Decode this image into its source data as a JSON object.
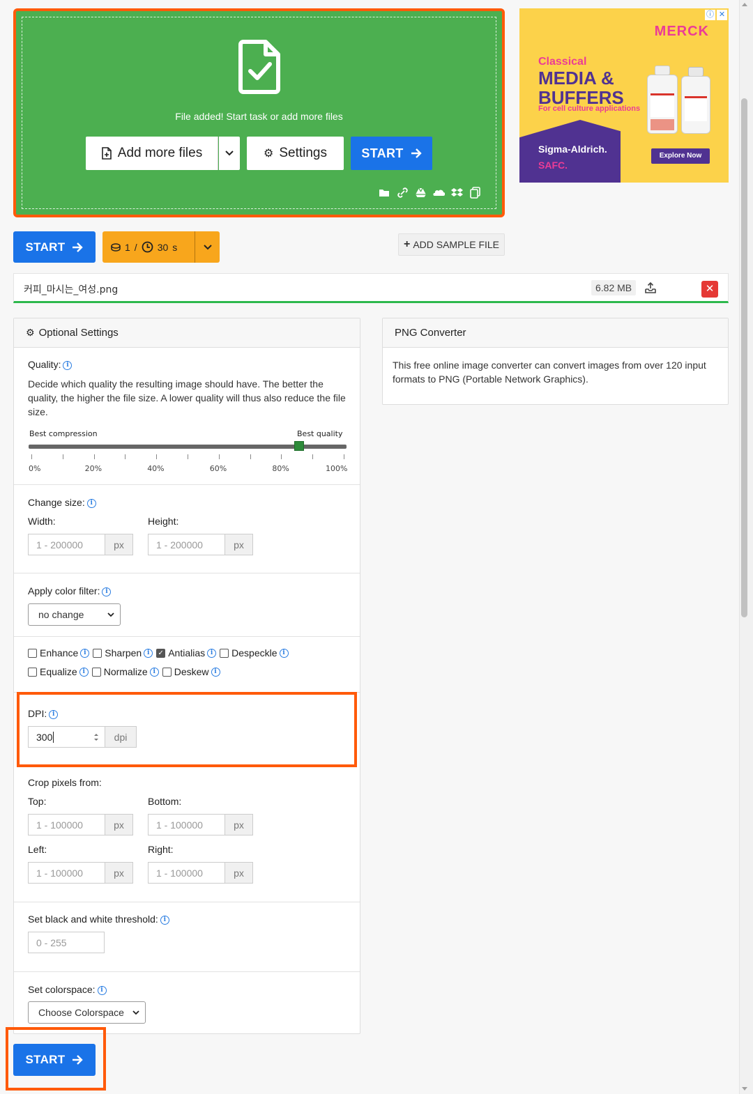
{
  "upload": {
    "message": "File added! Start task or add more files",
    "add_more_label": "Add more files",
    "settings_label": "Settings",
    "start_label": "START",
    "source_icons": [
      "folder-icon",
      "link-icon",
      "google-drive-icon",
      "onedrive-icon",
      "dropbox-icon",
      "clipboard-icon"
    ]
  },
  "ad": {
    "brand": "MERCK",
    "small_title": "Classical",
    "headline": "MEDIA & BUFFERS",
    "tagline": "For cell culture applications",
    "sigma": "Sigma-Aldrich.",
    "safc": "SAFC.",
    "cta": "Explore Now",
    "colors": {
      "bg": "#fcd24a",
      "purple": "#503291",
      "pink": "#eb3c96"
    }
  },
  "actions": {
    "start_label": "START",
    "credits_count": "1",
    "credits_sep": "/",
    "time_value": "30",
    "time_unit": "s",
    "sample_label": "ADD SAMPLE FILE"
  },
  "file": {
    "name": "커피_마시는_여성.png",
    "size": "6.82 MB",
    "delete_glyph": "✕"
  },
  "settings": {
    "title": "Optional Settings",
    "quality": {
      "label": "Quality:",
      "description": "Decide which quality the resulting image should have. The better the quality, the higher the file size. A lower quality will thus also reduce the file size.",
      "min_label": "Best compression",
      "max_label": "Best quality",
      "value_percent": 85,
      "ticks": [
        "0%",
        "20%",
        "40%",
        "60%",
        "80%",
        "100%"
      ]
    },
    "size": {
      "label": "Change size:",
      "width_label": "Width:",
      "height_label": "Height:",
      "placeholder": "1 - 200000",
      "unit": "px"
    },
    "color_filter": {
      "label": "Apply color filter:",
      "value": "no change"
    },
    "options": {
      "row1": [
        {
          "label": "Enhance",
          "checked": false
        },
        {
          "label": "Sharpen",
          "checked": false
        },
        {
          "label": "Antialias",
          "checked": true
        },
        {
          "label": "Despeckle",
          "checked": false
        }
      ],
      "row2": [
        {
          "label": "Equalize",
          "checked": false
        },
        {
          "label": "Normalize",
          "checked": false
        },
        {
          "label": "Deskew",
          "checked": false
        }
      ]
    },
    "dpi": {
      "label": "DPI:",
      "value": "300",
      "unit": "dpi"
    },
    "crop": {
      "label": "Crop pixels from:",
      "top_label": "Top:",
      "bottom_label": "Bottom:",
      "left_label": "Left:",
      "right_label": "Right:",
      "placeholder": "1 - 100000",
      "unit": "px"
    },
    "threshold": {
      "label": "Set black and white threshold:",
      "placeholder": "0 - 255"
    },
    "colorspace": {
      "label": "Set colorspace:",
      "value": "Choose Colorspace"
    }
  },
  "converter": {
    "title": "PNG Converter",
    "description": "This free online image converter can convert images from over 120 input formats to PNG (Portable Network Graphics)."
  },
  "bottom": {
    "start_label": "START"
  },
  "colors": {
    "upload_green": "#4caf50",
    "primary_blue": "#1a73e8",
    "credits_orange": "#f8a61c",
    "highlight_orange": "#ff5a0a",
    "delete_red": "#e53935",
    "progress_green": "#2db84d"
  }
}
